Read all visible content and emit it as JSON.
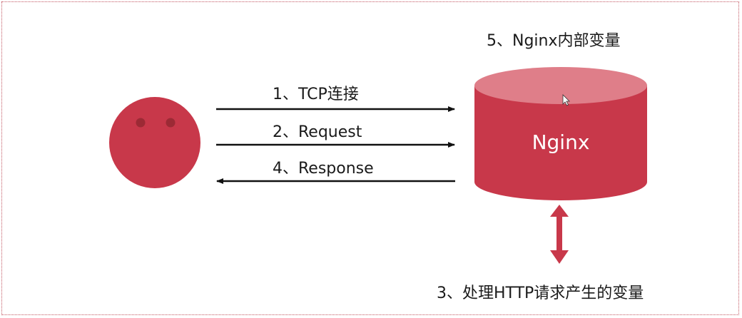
{
  "labels": {
    "tcp": "1、TCP连接",
    "request": "2、Request",
    "response": "4、Response",
    "process": "3、处理HTTP请求产生的变量",
    "internal": "5、Nginx内部变量",
    "server": "Nginx"
  },
  "colors": {
    "red": "#c8384a",
    "red_top": "#df7e89",
    "frame": "#c25560",
    "arrow": "#111111"
  }
}
